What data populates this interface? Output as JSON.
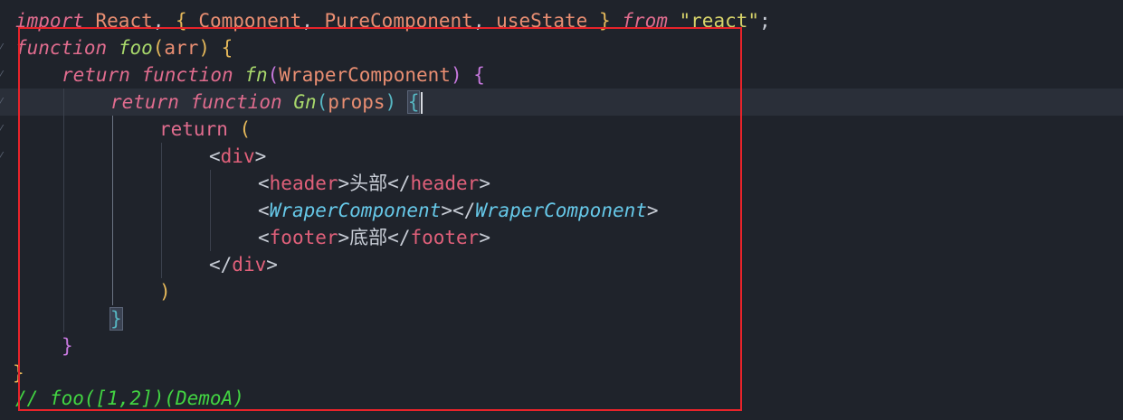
{
  "colors": {
    "background": "#1f232b",
    "highlight_line": "#2a2f39",
    "annotation_box": "#e8232a"
  },
  "code": {
    "l1": {
      "kw_import": "import",
      "react": "React",
      "comma1": ",",
      "lbrace": "{",
      "component": "Component",
      "comma2": ",",
      "pure": "PureComponent",
      "comma3": ",",
      "usestate": "useState",
      "rbrace": "}",
      "kw_from": "from",
      "module": "\"react\"",
      "semi": ";"
    },
    "l2": {
      "kw_function": "function",
      "name": "foo",
      "lparen": "(",
      "param": "arr",
      "rparen": ")",
      "brace": "{"
    },
    "l3": {
      "kw_return": "return",
      "kw_function": "function",
      "name": "fn",
      "lparen": "(",
      "param": "WraperComponent",
      "rparen": ")",
      "brace": "{"
    },
    "l4": {
      "kw_return": "return",
      "kw_function": "function",
      "name": "Gn",
      "lparen": "(",
      "param": "props",
      "rparen": ")",
      "brace": "{"
    },
    "l5": {
      "kw_return": "return",
      "paren": "("
    },
    "l6": {
      "open": "<",
      "tag": "div",
      "close": ">"
    },
    "l7": {
      "open1": "<",
      "tag1": "header",
      "close1": ">",
      "text": "头部",
      "open2": "</",
      "tag2": "header",
      "close2": ">"
    },
    "l8": {
      "open1": "<",
      "comp1": "WraperComponent",
      "close1": "></",
      "comp2": "WraperComponent",
      "close2": ">"
    },
    "l9": {
      "open1": "<",
      "tag1": "footer",
      "close1": ">",
      "text": "底部",
      "open2": "</",
      "tag2": "footer",
      "close2": ">"
    },
    "l10": {
      "open": "</",
      "tag": "div",
      "close": ">"
    },
    "l11": {
      "paren": ")"
    },
    "l12": {
      "brace": "}"
    },
    "l13": {
      "brace": "}"
    },
    "l14": {
      "brace": "}"
    },
    "l15": {
      "comment": "// foo([1,2])(DemoA)"
    }
  }
}
